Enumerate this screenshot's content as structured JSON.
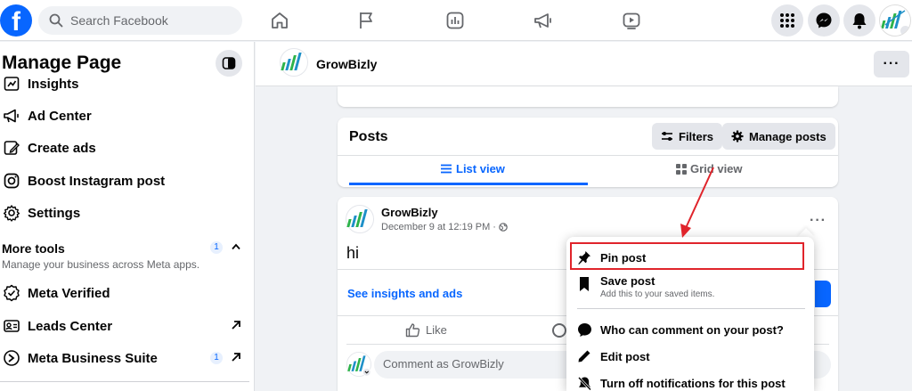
{
  "topbar": {
    "search_placeholder": "Search Facebook",
    "nav_icons": [
      "home-icon",
      "flag-icon",
      "chart-icon",
      "megaphone-icon",
      "video-icon"
    ],
    "right_icons": [
      "grid-menu-icon",
      "messenger-icon",
      "bell-icon"
    ]
  },
  "sidebar": {
    "title": "Manage Page",
    "items": [
      {
        "label": "Insights",
        "icon": "insights-icon"
      },
      {
        "label": "Ad Center",
        "icon": "megaphone-icon"
      },
      {
        "label": "Create ads",
        "icon": "pencil-icon"
      },
      {
        "label": "Boost Instagram post",
        "icon": "instagram-icon"
      },
      {
        "label": "Settings",
        "icon": "gear-icon"
      }
    ],
    "more_tools": {
      "title": "More tools",
      "subtitle": "Manage your business across Meta apps.",
      "badge": "1"
    },
    "tools": [
      {
        "label": "Meta Verified",
        "icon": "verified-icon"
      },
      {
        "label": "Leads Center",
        "icon": "leads-icon"
      },
      {
        "label": "Meta Business Suite",
        "icon": "business-suite-icon",
        "badge": "1"
      }
    ]
  },
  "page_header": {
    "name": "GrowBizly",
    "more": "···"
  },
  "posts_card": {
    "title": "Posts",
    "filters_label": "Filters",
    "manage_label": "Manage posts",
    "tabs": [
      {
        "label": "List view",
        "active": true
      },
      {
        "label": "Grid view",
        "active": false
      }
    ]
  },
  "post": {
    "author": "GrowBizly",
    "date": "December 9 at 12:19 PM",
    "separator": "·",
    "body": "hi",
    "insights_link": "See insights and ads",
    "like_label": "Like",
    "comment_placeholder": "Comment as GrowBizly",
    "dots": "···"
  },
  "menu": {
    "items": [
      {
        "label": "Pin post",
        "icon": "pin-icon",
        "highlighted": true
      },
      {
        "label": "Save post",
        "sublabel": "Add this to your saved items.",
        "icon": "bookmark-icon"
      },
      {
        "label": "Who can comment on your post?",
        "icon": "comment-bubble-icon"
      },
      {
        "label": "Edit post",
        "icon": "pencil-icon"
      },
      {
        "label": "Turn off notifications for this post",
        "icon": "bell-off-icon"
      }
    ]
  },
  "colors": {
    "brand_blue": "#0866ff",
    "annotation_red": "#e0242b",
    "page_bg": "#f0f2f5"
  }
}
